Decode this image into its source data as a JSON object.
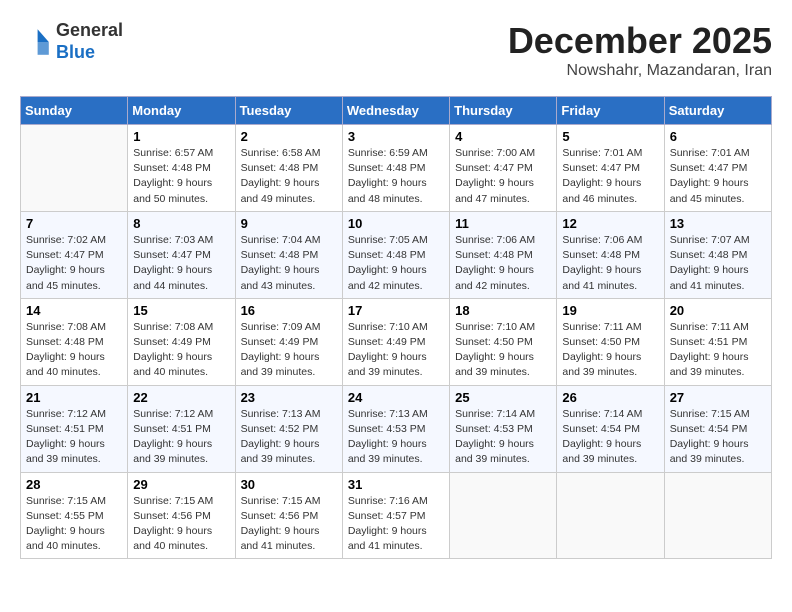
{
  "header": {
    "logo_line1": "General",
    "logo_line2": "Blue",
    "month_year": "December 2025",
    "location": "Nowshahr, Mazandaran, Iran"
  },
  "days_of_week": [
    "Sunday",
    "Monday",
    "Tuesday",
    "Wednesday",
    "Thursday",
    "Friday",
    "Saturday"
  ],
  "weeks": [
    [
      {
        "num": "",
        "info": ""
      },
      {
        "num": "1",
        "info": "Sunrise: 6:57 AM\nSunset: 4:48 PM\nDaylight: 9 hours\nand 50 minutes."
      },
      {
        "num": "2",
        "info": "Sunrise: 6:58 AM\nSunset: 4:48 PM\nDaylight: 9 hours\nand 49 minutes."
      },
      {
        "num": "3",
        "info": "Sunrise: 6:59 AM\nSunset: 4:48 PM\nDaylight: 9 hours\nand 48 minutes."
      },
      {
        "num": "4",
        "info": "Sunrise: 7:00 AM\nSunset: 4:47 PM\nDaylight: 9 hours\nand 47 minutes."
      },
      {
        "num": "5",
        "info": "Sunrise: 7:01 AM\nSunset: 4:47 PM\nDaylight: 9 hours\nand 46 minutes."
      },
      {
        "num": "6",
        "info": "Sunrise: 7:01 AM\nSunset: 4:47 PM\nDaylight: 9 hours\nand 45 minutes."
      }
    ],
    [
      {
        "num": "7",
        "info": "Sunrise: 7:02 AM\nSunset: 4:47 PM\nDaylight: 9 hours\nand 45 minutes."
      },
      {
        "num": "8",
        "info": "Sunrise: 7:03 AM\nSunset: 4:47 PM\nDaylight: 9 hours\nand 44 minutes."
      },
      {
        "num": "9",
        "info": "Sunrise: 7:04 AM\nSunset: 4:48 PM\nDaylight: 9 hours\nand 43 minutes."
      },
      {
        "num": "10",
        "info": "Sunrise: 7:05 AM\nSunset: 4:48 PM\nDaylight: 9 hours\nand 42 minutes."
      },
      {
        "num": "11",
        "info": "Sunrise: 7:06 AM\nSunset: 4:48 PM\nDaylight: 9 hours\nand 42 minutes."
      },
      {
        "num": "12",
        "info": "Sunrise: 7:06 AM\nSunset: 4:48 PM\nDaylight: 9 hours\nand 41 minutes."
      },
      {
        "num": "13",
        "info": "Sunrise: 7:07 AM\nSunset: 4:48 PM\nDaylight: 9 hours\nand 41 minutes."
      }
    ],
    [
      {
        "num": "14",
        "info": "Sunrise: 7:08 AM\nSunset: 4:48 PM\nDaylight: 9 hours\nand 40 minutes."
      },
      {
        "num": "15",
        "info": "Sunrise: 7:08 AM\nSunset: 4:49 PM\nDaylight: 9 hours\nand 40 minutes."
      },
      {
        "num": "16",
        "info": "Sunrise: 7:09 AM\nSunset: 4:49 PM\nDaylight: 9 hours\nand 39 minutes."
      },
      {
        "num": "17",
        "info": "Sunrise: 7:10 AM\nSunset: 4:49 PM\nDaylight: 9 hours\nand 39 minutes."
      },
      {
        "num": "18",
        "info": "Sunrise: 7:10 AM\nSunset: 4:50 PM\nDaylight: 9 hours\nand 39 minutes."
      },
      {
        "num": "19",
        "info": "Sunrise: 7:11 AM\nSunset: 4:50 PM\nDaylight: 9 hours\nand 39 minutes."
      },
      {
        "num": "20",
        "info": "Sunrise: 7:11 AM\nSunset: 4:51 PM\nDaylight: 9 hours\nand 39 minutes."
      }
    ],
    [
      {
        "num": "21",
        "info": "Sunrise: 7:12 AM\nSunset: 4:51 PM\nDaylight: 9 hours\nand 39 minutes."
      },
      {
        "num": "22",
        "info": "Sunrise: 7:12 AM\nSunset: 4:51 PM\nDaylight: 9 hours\nand 39 minutes."
      },
      {
        "num": "23",
        "info": "Sunrise: 7:13 AM\nSunset: 4:52 PM\nDaylight: 9 hours\nand 39 minutes."
      },
      {
        "num": "24",
        "info": "Sunrise: 7:13 AM\nSunset: 4:53 PM\nDaylight: 9 hours\nand 39 minutes."
      },
      {
        "num": "25",
        "info": "Sunrise: 7:14 AM\nSunset: 4:53 PM\nDaylight: 9 hours\nand 39 minutes."
      },
      {
        "num": "26",
        "info": "Sunrise: 7:14 AM\nSunset: 4:54 PM\nDaylight: 9 hours\nand 39 minutes."
      },
      {
        "num": "27",
        "info": "Sunrise: 7:15 AM\nSunset: 4:54 PM\nDaylight: 9 hours\nand 39 minutes."
      }
    ],
    [
      {
        "num": "28",
        "info": "Sunrise: 7:15 AM\nSunset: 4:55 PM\nDaylight: 9 hours\nand 40 minutes."
      },
      {
        "num": "29",
        "info": "Sunrise: 7:15 AM\nSunset: 4:56 PM\nDaylight: 9 hours\nand 40 minutes."
      },
      {
        "num": "30",
        "info": "Sunrise: 7:15 AM\nSunset: 4:56 PM\nDaylight: 9 hours\nand 41 minutes."
      },
      {
        "num": "31",
        "info": "Sunrise: 7:16 AM\nSunset: 4:57 PM\nDaylight: 9 hours\nand 41 minutes."
      },
      {
        "num": "",
        "info": ""
      },
      {
        "num": "",
        "info": ""
      },
      {
        "num": "",
        "info": ""
      }
    ]
  ]
}
